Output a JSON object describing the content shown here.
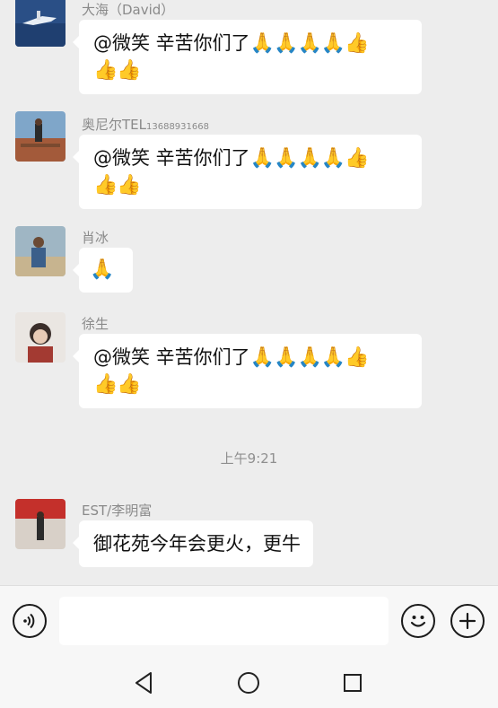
{
  "messages": [
    {
      "sender": "大海（David）",
      "sender_note": "",
      "text": "@微笑  辛苦你们了",
      "emoji_line1": "🙏🙏🙏🙏👍",
      "emoji_line2": "👍👍"
    },
    {
      "sender": "奥尼尔TEL",
      "sender_note": "13688931668",
      "text": "@微笑  辛苦你们了",
      "emoji_line1": "🙏🙏🙏🙏👍",
      "emoji_line2": "👍👍"
    },
    {
      "sender": "肖冰",
      "sender_note": "",
      "emoji_only": "🙏"
    },
    {
      "sender": "徐生",
      "sender_note": "",
      "text": "@微笑  辛苦你们了",
      "emoji_line1": "🙏🙏🙏🙏👍",
      "emoji_line2": "👍👍"
    },
    {
      "sender": "EST/李明富",
      "sender_note": "",
      "text": "御花苑今年会更火，更牛"
    }
  ],
  "timestamp": "上午9:21",
  "input": {
    "placeholder": "",
    "value": ""
  },
  "icons": {
    "voice": "voice-icon",
    "emoji": "emoji-icon",
    "plus": "plus-icon",
    "back": "back-triangle-icon",
    "home": "home-circle-icon",
    "recents": "recents-square-icon"
  },
  "colors": {
    "background": "#ededed",
    "bubble": "#ffffff",
    "bar": "#f7f7f7"
  }
}
